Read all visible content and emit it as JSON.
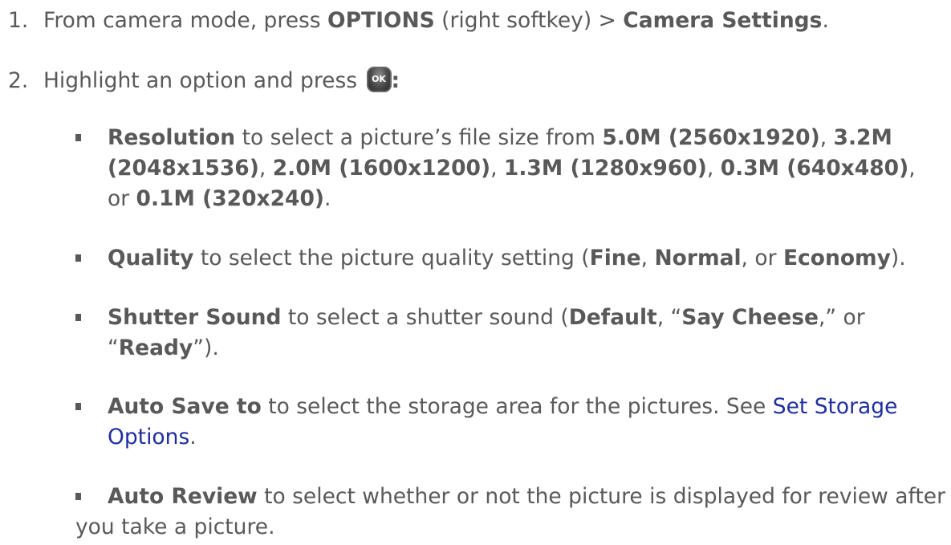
{
  "step1": {
    "number": "1.",
    "text_a": "From camera mode, press ",
    "options_label": "OPTIONS",
    "text_b": " (right softkey) > ",
    "camera_settings_label": "Camera Settings",
    "text_c": "."
  },
  "step2": {
    "number": "2.",
    "text_a": "Highlight an option and press ",
    "ok_label": "OK",
    "text_b": ":"
  },
  "bullets": {
    "resolution": {
      "term": "Resolution",
      "t1": " to select a picture’s file size from ",
      "o1": "5.0M (2560x1920)",
      "s1": ", ",
      "o2a": "3.2M",
      "o2b": "(2048x1536)",
      "s2": ", ",
      "o3": "2.0M (1600x1200)",
      "s3": ", ",
      "o4": "1.3M (1280x960)",
      "s4": ", ",
      "o5": "0.3M (640x480)",
      "s5": ",",
      "or": "or ",
      "o6": "0.1M (320x240)",
      "end": "."
    },
    "quality": {
      "term": "Quality",
      "t1": " to select the picture quality setting (",
      "o1": "Fine",
      "s1": ", ",
      "o2": "Normal",
      "s2": ", or ",
      "o3": "Economy",
      "end": ")."
    },
    "shutter": {
      "term": "Shutter Sound",
      "t1": " to select a shutter sound (",
      "o1": "Default",
      "s1": ", “",
      "o2": "Say Cheese",
      "s2": ",” or",
      "s3": "“",
      "o3": "Ready",
      "end": "”)."
    },
    "autosave": {
      "term": "Auto Save to",
      "t1": " to select the storage area for the pictures. See ",
      "link_a": "Set Storage",
      "link_b": "Options",
      "end": "."
    },
    "autoreview": {
      "term": "Auto Review",
      "t1": " to select whether or not the picture is displayed for review after",
      "t2": "you take a picture."
    }
  }
}
